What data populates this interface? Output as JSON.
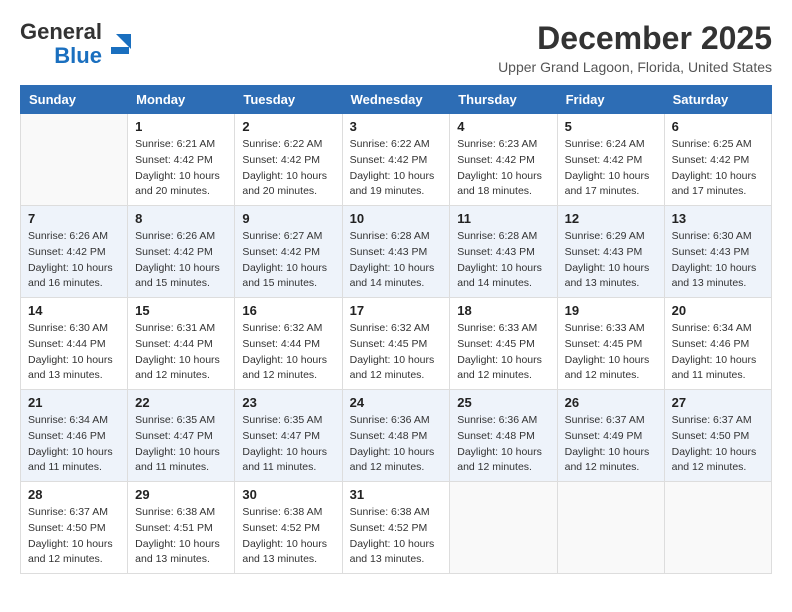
{
  "header": {
    "logo_line1": "General",
    "logo_line2": "Blue",
    "month": "December 2025",
    "location": "Upper Grand Lagoon, Florida, United States"
  },
  "weekdays": [
    "Sunday",
    "Monday",
    "Tuesday",
    "Wednesday",
    "Thursday",
    "Friday",
    "Saturday"
  ],
  "weeks": [
    [
      {
        "day": "",
        "info": ""
      },
      {
        "day": "1",
        "info": "Sunrise: 6:21 AM\nSunset: 4:42 PM\nDaylight: 10 hours\nand 20 minutes."
      },
      {
        "day": "2",
        "info": "Sunrise: 6:22 AM\nSunset: 4:42 PM\nDaylight: 10 hours\nand 20 minutes."
      },
      {
        "day": "3",
        "info": "Sunrise: 6:22 AM\nSunset: 4:42 PM\nDaylight: 10 hours\nand 19 minutes."
      },
      {
        "day": "4",
        "info": "Sunrise: 6:23 AM\nSunset: 4:42 PM\nDaylight: 10 hours\nand 18 minutes."
      },
      {
        "day": "5",
        "info": "Sunrise: 6:24 AM\nSunset: 4:42 PM\nDaylight: 10 hours\nand 17 minutes."
      },
      {
        "day": "6",
        "info": "Sunrise: 6:25 AM\nSunset: 4:42 PM\nDaylight: 10 hours\nand 17 minutes."
      }
    ],
    [
      {
        "day": "7",
        "info": "Sunrise: 6:26 AM\nSunset: 4:42 PM\nDaylight: 10 hours\nand 16 minutes."
      },
      {
        "day": "8",
        "info": "Sunrise: 6:26 AM\nSunset: 4:42 PM\nDaylight: 10 hours\nand 15 minutes."
      },
      {
        "day": "9",
        "info": "Sunrise: 6:27 AM\nSunset: 4:42 PM\nDaylight: 10 hours\nand 15 minutes."
      },
      {
        "day": "10",
        "info": "Sunrise: 6:28 AM\nSunset: 4:43 PM\nDaylight: 10 hours\nand 14 minutes."
      },
      {
        "day": "11",
        "info": "Sunrise: 6:28 AM\nSunset: 4:43 PM\nDaylight: 10 hours\nand 14 minutes."
      },
      {
        "day": "12",
        "info": "Sunrise: 6:29 AM\nSunset: 4:43 PM\nDaylight: 10 hours\nand 13 minutes."
      },
      {
        "day": "13",
        "info": "Sunrise: 6:30 AM\nSunset: 4:43 PM\nDaylight: 10 hours\nand 13 minutes."
      }
    ],
    [
      {
        "day": "14",
        "info": "Sunrise: 6:30 AM\nSunset: 4:44 PM\nDaylight: 10 hours\nand 13 minutes."
      },
      {
        "day": "15",
        "info": "Sunrise: 6:31 AM\nSunset: 4:44 PM\nDaylight: 10 hours\nand 12 minutes."
      },
      {
        "day": "16",
        "info": "Sunrise: 6:32 AM\nSunset: 4:44 PM\nDaylight: 10 hours\nand 12 minutes."
      },
      {
        "day": "17",
        "info": "Sunrise: 6:32 AM\nSunset: 4:45 PM\nDaylight: 10 hours\nand 12 minutes."
      },
      {
        "day": "18",
        "info": "Sunrise: 6:33 AM\nSunset: 4:45 PM\nDaylight: 10 hours\nand 12 minutes."
      },
      {
        "day": "19",
        "info": "Sunrise: 6:33 AM\nSunset: 4:45 PM\nDaylight: 10 hours\nand 12 minutes."
      },
      {
        "day": "20",
        "info": "Sunrise: 6:34 AM\nSunset: 4:46 PM\nDaylight: 10 hours\nand 11 minutes."
      }
    ],
    [
      {
        "day": "21",
        "info": "Sunrise: 6:34 AM\nSunset: 4:46 PM\nDaylight: 10 hours\nand 11 minutes."
      },
      {
        "day": "22",
        "info": "Sunrise: 6:35 AM\nSunset: 4:47 PM\nDaylight: 10 hours\nand 11 minutes."
      },
      {
        "day": "23",
        "info": "Sunrise: 6:35 AM\nSunset: 4:47 PM\nDaylight: 10 hours\nand 11 minutes."
      },
      {
        "day": "24",
        "info": "Sunrise: 6:36 AM\nSunset: 4:48 PM\nDaylight: 10 hours\nand 12 minutes."
      },
      {
        "day": "25",
        "info": "Sunrise: 6:36 AM\nSunset: 4:48 PM\nDaylight: 10 hours\nand 12 minutes."
      },
      {
        "day": "26",
        "info": "Sunrise: 6:37 AM\nSunset: 4:49 PM\nDaylight: 10 hours\nand 12 minutes."
      },
      {
        "day": "27",
        "info": "Sunrise: 6:37 AM\nSunset: 4:50 PM\nDaylight: 10 hours\nand 12 minutes."
      }
    ],
    [
      {
        "day": "28",
        "info": "Sunrise: 6:37 AM\nSunset: 4:50 PM\nDaylight: 10 hours\nand 12 minutes."
      },
      {
        "day": "29",
        "info": "Sunrise: 6:38 AM\nSunset: 4:51 PM\nDaylight: 10 hours\nand 13 minutes."
      },
      {
        "day": "30",
        "info": "Sunrise: 6:38 AM\nSunset: 4:52 PM\nDaylight: 10 hours\nand 13 minutes."
      },
      {
        "day": "31",
        "info": "Sunrise: 6:38 AM\nSunset: 4:52 PM\nDaylight: 10 hours\nand 13 minutes."
      },
      {
        "day": "",
        "info": ""
      },
      {
        "day": "",
        "info": ""
      },
      {
        "day": "",
        "info": ""
      }
    ]
  ]
}
